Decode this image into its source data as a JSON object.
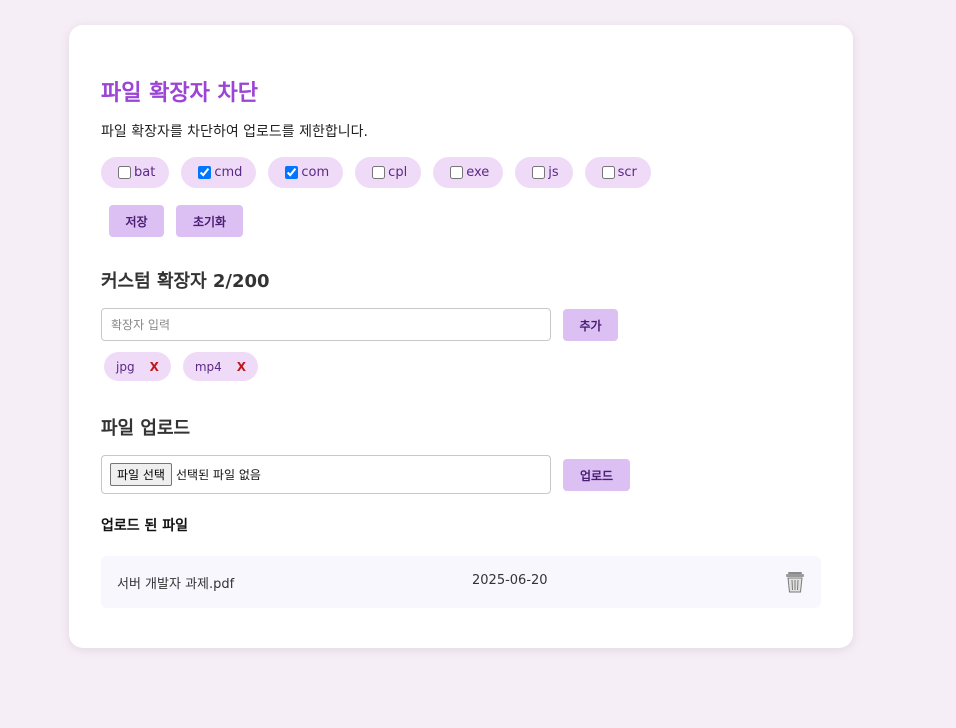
{
  "header": {
    "title": "파일 확장자 차단",
    "description": "파일 확장자를 차단하여 업로드를 제한합니다."
  },
  "fixed_extensions": [
    {
      "label": "bat",
      "checked": false
    },
    {
      "label": "cmd",
      "checked": true
    },
    {
      "label": "com",
      "checked": true
    },
    {
      "label": "cpl",
      "checked": false
    },
    {
      "label": "exe",
      "checked": false
    },
    {
      "label": "js",
      "checked": false
    },
    {
      "label": "scr",
      "checked": false
    }
  ],
  "actions": {
    "save_label": "저장",
    "reset_label": "초기화"
  },
  "custom": {
    "heading": "커스텀 확장자 2/200",
    "input_placeholder": "확장자 입력",
    "add_label": "추가",
    "tags": [
      {
        "label": "jpg",
        "remove": "X"
      },
      {
        "label": "mp4",
        "remove": "X"
      }
    ]
  },
  "upload": {
    "heading": "파일 업로드",
    "choose_label": "파일 선택",
    "no_file_text": "선택된 파일 없음",
    "upload_label": "업로드"
  },
  "uploaded": {
    "heading": "업로드 된 파일",
    "files": [
      {
        "name": "서버 개발자 과제.pdf",
        "date": "2025-06-20",
        "icon": "trash-icon"
      }
    ]
  },
  "colors": {
    "title": "#9b44d6",
    "chip_bg": "#efdbf7",
    "button_bg": "#dcc0f3",
    "remove_x": "#c01818",
    "page_bg": "#f6eef6"
  }
}
